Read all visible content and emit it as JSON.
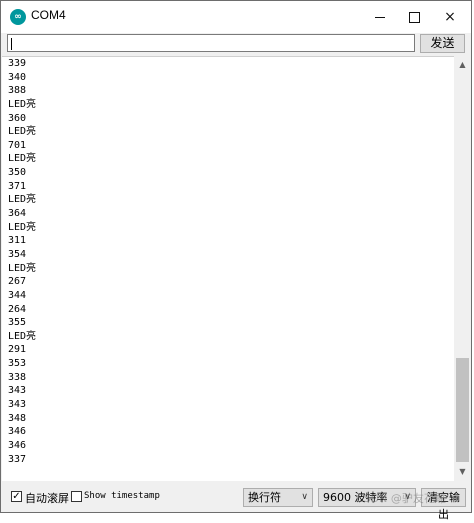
{
  "window": {
    "title": "COM4",
    "icon": "arduino-icon",
    "controls": {
      "minimize": "minimize-icon",
      "maximize": "maximize-icon",
      "close": "×"
    }
  },
  "send": {
    "input_value": "",
    "button_label": "发送"
  },
  "output_lines": [
    "339",
    "340",
    "388",
    "LED亮",
    "360",
    "LED亮",
    "701",
    "LED亮",
    "350",
    "371",
    "LED亮",
    "364",
    "LED亮",
    "311",
    "354",
    "LED亮",
    "267",
    "344",
    "264",
    "355",
    "LED亮",
    "291",
    "353",
    "338",
    "343",
    "343",
    "348",
    "346",
    "346",
    "337"
  ],
  "bottom": {
    "autoscroll_label": "自动滚屏",
    "autoscroll_checked": true,
    "timestamp_label": "Show timestamp",
    "timestamp_checked": false,
    "line_ending": "换行符",
    "baud_rate": "9600 波特率",
    "clear_label": "清空输出"
  },
  "watermark": "CSDN @驴友花雕"
}
